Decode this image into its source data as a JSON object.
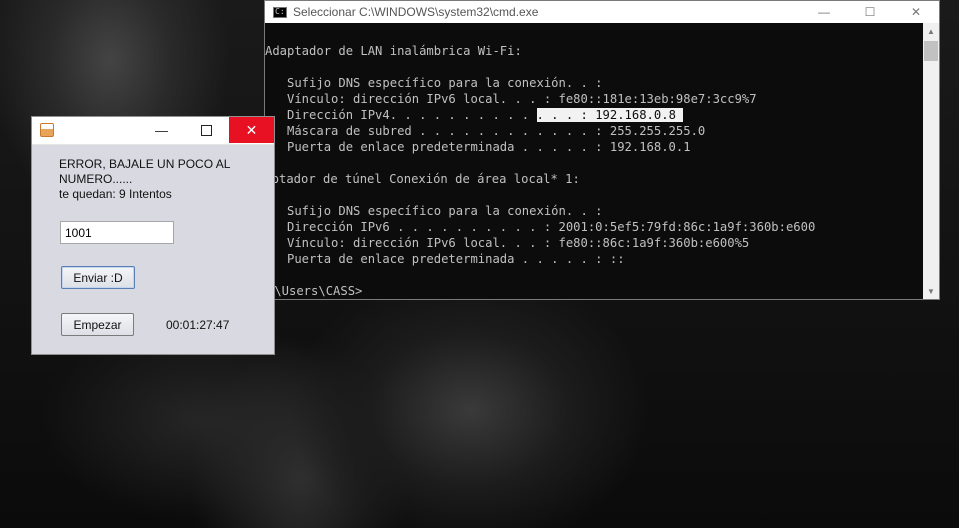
{
  "cmd": {
    "title": "Seleccionar C:\\WINDOWS\\system32\\cmd.exe",
    "controls": {
      "minimize": "—",
      "maximize": "☐",
      "close": "✕"
    },
    "lines": [
      {
        "pre": "Adaptador de LAN inalámbrica Wi-Fi:",
        "sel": "",
        "post": ""
      },
      {
        "pre": "   Sufijo DNS específico para la conexión. . :",
        "sel": "",
        "post": ""
      },
      {
        "pre": "   Vínculo: dirección IPv6 local. . . : fe80::181e:13eb:98e7:3cc9%7",
        "sel": "",
        "post": ""
      },
      {
        "pre": "   Dirección IPv4. . . . . . . . . . ",
        "sel": ". . . : 192.168.0.8 ",
        "post": ""
      },
      {
        "pre": "   Máscara de subred . . . . . . . . . . . . : 255.255.255.0",
        "sel": "",
        "post": ""
      },
      {
        "pre": "   Puerta de enlace predeterminada . . . . . : 192.168.0.1",
        "sel": "",
        "post": ""
      },
      {
        "pre": "daptador de túnel Conexión de área local* 1:",
        "sel": "",
        "post": ""
      },
      {
        "pre": "   Sufijo DNS específico para la conexión. . :",
        "sel": "",
        "post": ""
      },
      {
        "pre": "   Dirección IPv6 . . . . . . . . . . : 2001:0:5ef5:79fd:86c:1a9f:360b:e600",
        "sel": "",
        "post": ""
      },
      {
        "pre": "   Vínculo: dirección IPv6 local. . . : fe80::86c:1a9f:360b:e600%5",
        "sel": "",
        "post": ""
      },
      {
        "pre": "   Puerta de enlace predeterminada . . . . . : ::",
        "sel": "",
        "post": ""
      },
      {
        "pre": ":\\Users\\CASS>",
        "sel": "",
        "post": ""
      }
    ],
    "scroll": {
      "up": "▲",
      "down": "▼"
    }
  },
  "java": {
    "controls": {
      "minimize": "—",
      "close": "✕"
    },
    "message_line1": "ERROR, BAJALE UN POCO AL",
    "message_line2": "NUMERO......",
    "message_line3": "te quedan: 9 Intentos",
    "input_value": "1001",
    "send_button": "Enviar :D",
    "start_button": "Empezar",
    "timer": "00:01:27:47"
  }
}
